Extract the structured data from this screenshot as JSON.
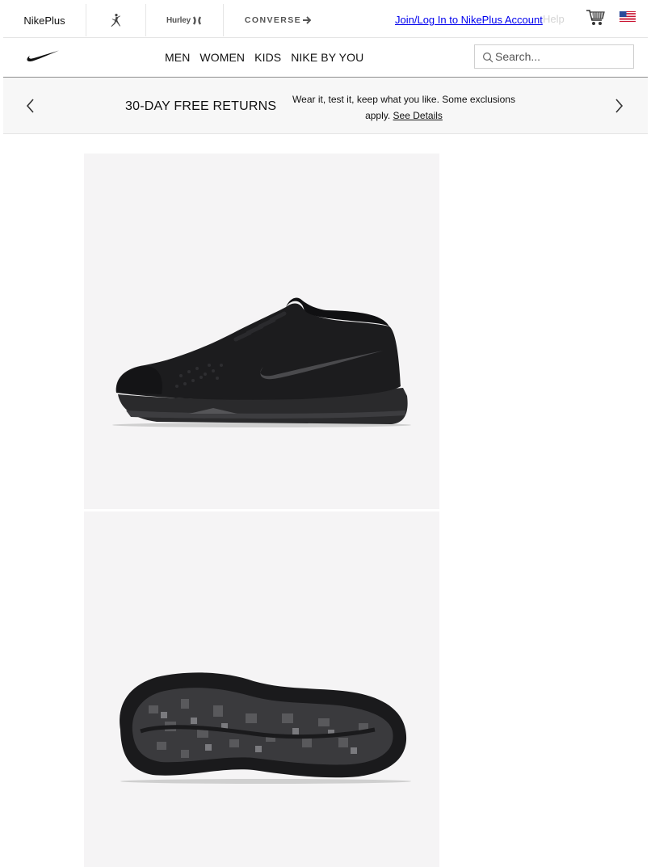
{
  "brandbar": {
    "nikeplus": "NikePlus",
    "jordan_icon": "jordan-jumpman-icon",
    "hurley": "Hurley",
    "converse": "CONVERSE",
    "join_link": "Join/Log In to NikePlus Account",
    "help_link": "Help",
    "cart_icon": "shopping-cart-icon",
    "flag_icon": "us-flag-icon"
  },
  "navbar": {
    "logo": "nike-swoosh-logo",
    "links": [
      "MEN",
      "WOMEN",
      "KIDS",
      "NIKE BY YOU"
    ],
    "search_placeholder": "Search..."
  },
  "promo": {
    "title": "30-DAY FREE RETURNS",
    "text": "Wear it, test it, keep what you like. Some exclusions apply.",
    "link": "See Details"
  },
  "product": {
    "images": [
      "shoe-side-view",
      "shoe-outsole-view"
    ]
  },
  "colors": {
    "link_blue": "#0000ee",
    "image_bg": "#f5f4f5",
    "promo_bg": "#f7f7f7"
  }
}
